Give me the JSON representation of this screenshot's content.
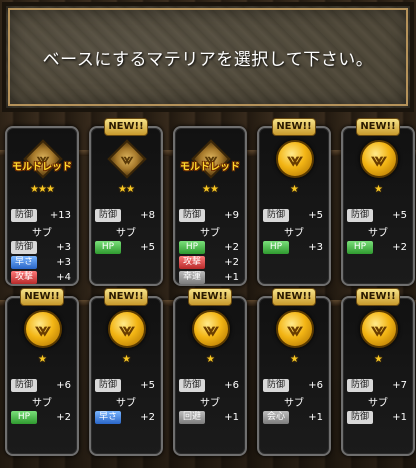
{
  "banner": {
    "text": "ベースにするマテリアを選択して下さい。"
  },
  "badge_new": "NEW!!",
  "colors": {
    "star": "#f5c623",
    "orb": "#f3b514",
    "label_green": "#2f9a2f",
    "label_blue": "#2a66c8",
    "label_red": "#b82a2a"
  },
  "cards": [
    {
      "new": false,
      "icon": "diamond-materia-icon",
      "name": "モルドレッド",
      "stars": "★★★",
      "main": {
        "label": "防御",
        "value": "+13"
      },
      "sub_header": "サブ",
      "subs": [
        {
          "label": "防御",
          "value": "+3",
          "color": "light"
        },
        {
          "label": "早さ",
          "value": "+3",
          "color": "blue"
        },
        {
          "label": "攻撃",
          "value": "+4",
          "color": "red"
        }
      ]
    },
    {
      "new": true,
      "icon": "diamond-materia-icon",
      "name": "",
      "stars": "★★",
      "main": {
        "label": "防御",
        "value": "+8"
      },
      "sub_header": "サブ",
      "subs": [
        {
          "label": "HP",
          "value": "+5",
          "color": "green"
        }
      ]
    },
    {
      "new": false,
      "icon": "diamond-materia-icon",
      "name": "モルドレッド",
      "stars": "★★",
      "main": {
        "label": "防御",
        "value": "+9"
      },
      "sub_header": "サブ",
      "subs": [
        {
          "label": "HP",
          "value": "+2",
          "color": "green"
        },
        {
          "label": "攻撃",
          "value": "+2",
          "color": "red"
        },
        {
          "label": "幸運",
          "value": "+1",
          "color": "gray"
        }
      ]
    },
    {
      "new": true,
      "icon": "gold-orb-materia-icon",
      "name": "",
      "stars": "★",
      "main": {
        "label": "防御",
        "value": "+5"
      },
      "sub_header": "サブ",
      "subs": [
        {
          "label": "HP",
          "value": "+3",
          "color": "green"
        }
      ]
    },
    {
      "new": true,
      "icon": "gold-orb-materia-icon",
      "name": "",
      "stars": "★",
      "main": {
        "label": "防御",
        "value": "+5"
      },
      "sub_header": "サブ",
      "subs": [
        {
          "label": "HP",
          "value": "+2",
          "color": "green"
        }
      ]
    },
    {
      "new": true,
      "icon": "gold-orb-materia-icon",
      "name": "",
      "stars": "★",
      "main": {
        "label": "防御",
        "value": "+6"
      },
      "sub_header": "サブ",
      "subs": [
        {
          "label": "HP",
          "value": "+2",
          "color": "green"
        }
      ]
    },
    {
      "new": true,
      "icon": "gold-orb-materia-icon",
      "name": "",
      "stars": "★",
      "main": {
        "label": "防御",
        "value": "+5"
      },
      "sub_header": "サブ",
      "subs": [
        {
          "label": "早さ",
          "value": "+2",
          "color": "blue"
        }
      ]
    },
    {
      "new": true,
      "icon": "gold-orb-materia-icon",
      "name": "",
      "stars": "★",
      "main": {
        "label": "防御",
        "value": "+6"
      },
      "sub_header": "サブ",
      "subs": [
        {
          "label": "回避",
          "value": "+1",
          "color": "gray"
        }
      ]
    },
    {
      "new": true,
      "icon": "gold-orb-materia-icon",
      "name": "",
      "stars": "★",
      "main": {
        "label": "防御",
        "value": "+6"
      },
      "sub_header": "サブ",
      "subs": [
        {
          "label": "会心",
          "value": "+1",
          "color": "gray"
        }
      ]
    },
    {
      "new": true,
      "icon": "gold-orb-materia-icon",
      "name": "",
      "stars": "★",
      "main": {
        "label": "防御",
        "value": "+7"
      },
      "sub_header": "サブ",
      "subs": [
        {
          "label": "防御",
          "value": "+1",
          "color": "light"
        }
      ]
    }
  ]
}
